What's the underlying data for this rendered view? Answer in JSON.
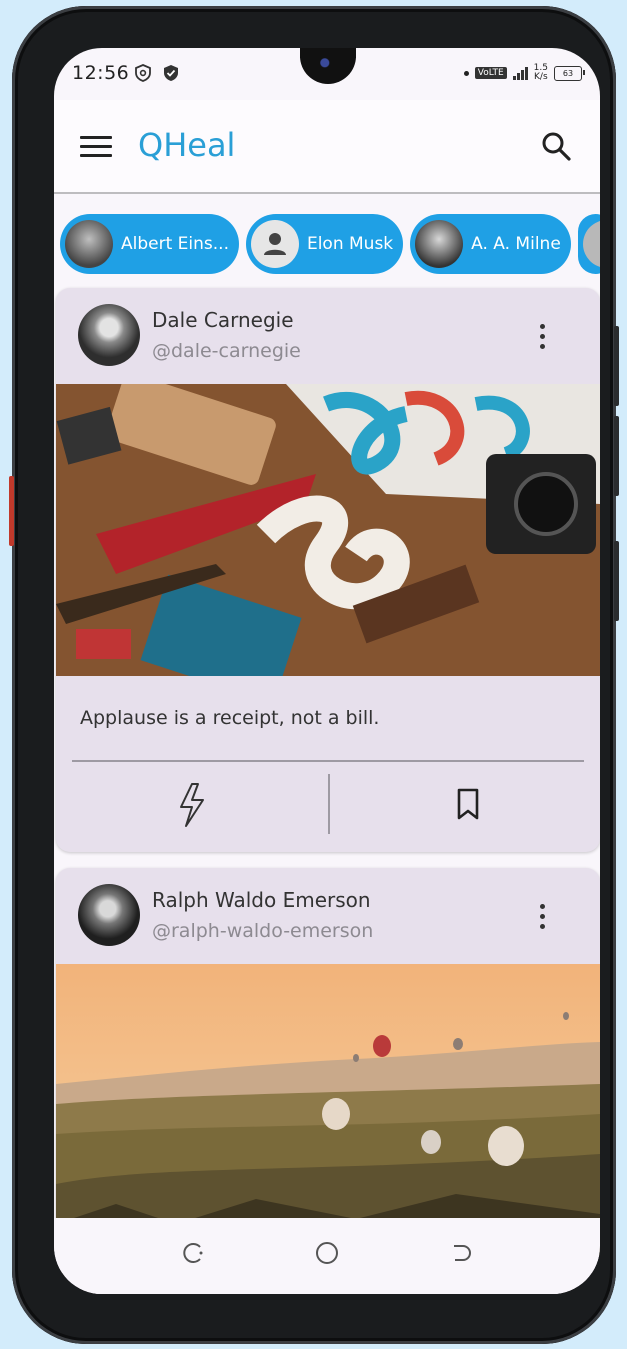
{
  "status_bar": {
    "time": "12:56",
    "network_label": "VoLTE",
    "speed_value": "1.5",
    "speed_unit": "K/s",
    "battery_level": "63"
  },
  "app_bar": {
    "title": "QHeal",
    "menu_icon": "menu-icon",
    "search_icon": "search-icon"
  },
  "authors": [
    {
      "label": "Albert Eins..."
    },
    {
      "label": "Elon Musk"
    },
    {
      "label": "A. A. Milne"
    }
  ],
  "posts": [
    {
      "author_name": "Dale Carnegie",
      "author_handle": "@dale-carnegie",
      "quote": "Applause is a receipt, not a bill.",
      "image_subject": "back-to-school still life with pennant and camera"
    },
    {
      "author_name": "Ralph Waldo Emerson",
      "author_handle": "@ralph-waldo-emerson",
      "image_subject": "hot air balloons over valley at sunrise"
    }
  ],
  "colors": {
    "accent": "#2a9fd6",
    "chip": "#1fa0e5",
    "card": "#e7e0ec"
  }
}
